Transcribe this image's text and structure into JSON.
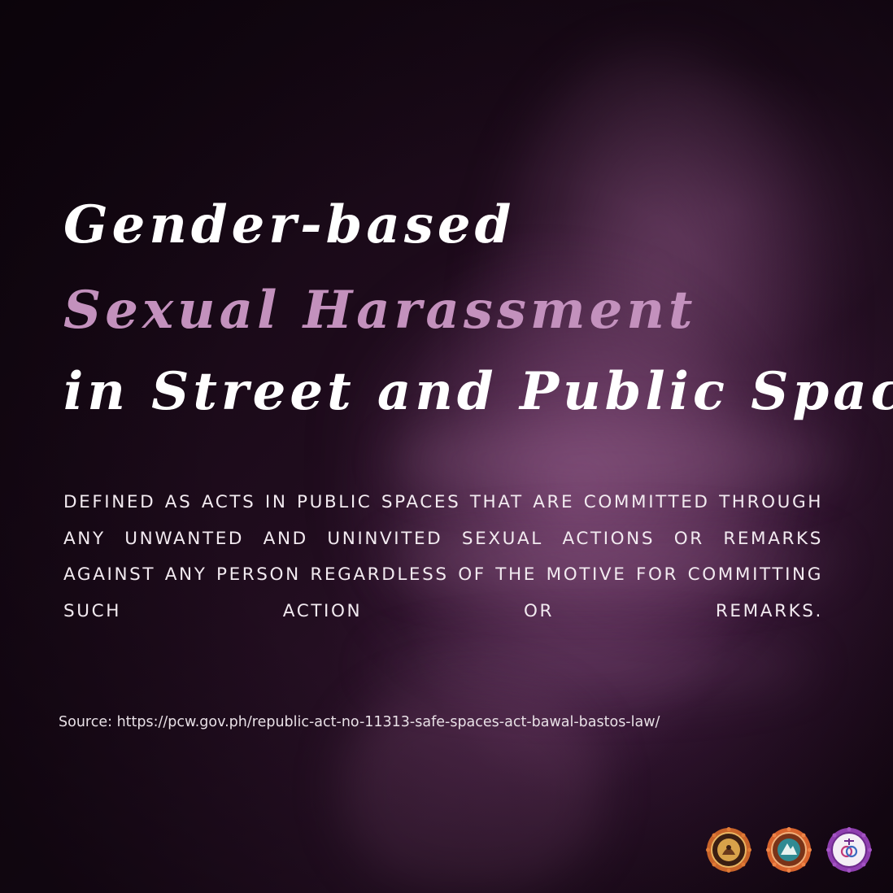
{
  "title": {
    "line1": "Gender-based",
    "line2": "Sexual Harassment",
    "line3": "in Street and Public Spaces"
  },
  "definition": "DEFINED AS ACTS IN PUBLIC SPACES THAT ARE COMMITTED THROUGH ANY UNWANTED AND UNINVITED SEXUAL ACTIONS OR REMARKS AGAINST ANY PERSON REGARDLESS OF THE MOTIVE FOR COMMITTING SUCH ACTION OR REMARKS.",
  "source": "Source: https://pcw.gov.ph/republic-act-no-11313-safe-spaces-act-bawal-bastos-law/",
  "logos": [
    {
      "icon": "university-seal-icon"
    },
    {
      "icon": "college-seal-icon"
    },
    {
      "icon": "gender-and-development-seal-icon"
    }
  ],
  "colors": {
    "accent": "#c391bd",
    "text": "#ffffff",
    "background": "#1f0c1d"
  }
}
